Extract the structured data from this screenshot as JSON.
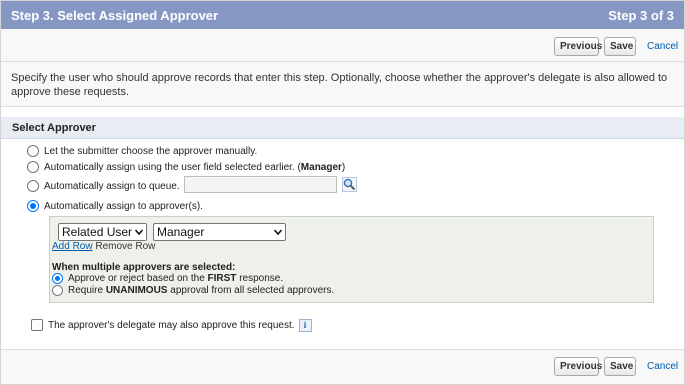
{
  "header": {
    "title": "Step 3. Select Assigned Approver",
    "step": "Step 3 of 3"
  },
  "toolbar": {
    "previous_label": "Previous",
    "save_label": "Save",
    "cancel_label": "Cancel"
  },
  "description": "Specify the user who should approve records that enter this step. Optionally, choose whether the approver's delegate is also allowed to approve these requests.",
  "section": {
    "title": "Select Approver"
  },
  "approver_options": {
    "manual": "Let the submitter choose the approver manually.",
    "user_field_prefix": "Automatically assign using the user field selected earlier. (",
    "user_field_name": "Manager",
    "user_field_suffix": ")",
    "queue": "Automatically assign to queue.",
    "approvers": "Automatically assign to approver(s).",
    "selected": "approvers"
  },
  "queue_input": {
    "value": ""
  },
  "approver_row": {
    "type_value": "Related User",
    "field_value": "Manager",
    "add_row": "Add Row",
    "remove_row": "Remove Row"
  },
  "multiple": {
    "title": "When multiple approvers are selected:",
    "first_prefix": "Approve or reject based on the ",
    "first_bold": "FIRST",
    "first_suffix": " response.",
    "unanimous_prefix": "Require ",
    "unanimous_bold": "UNANIMOUS",
    "unanimous_suffix": " approval from all selected approvers.",
    "selected": "first"
  },
  "delegate": {
    "label": "The approver's delegate may also approve this request.",
    "checked": false,
    "info_icon": "i"
  },
  "icons": {
    "lookup": "magnifier-lookup-icon",
    "info": "info-icon"
  }
}
